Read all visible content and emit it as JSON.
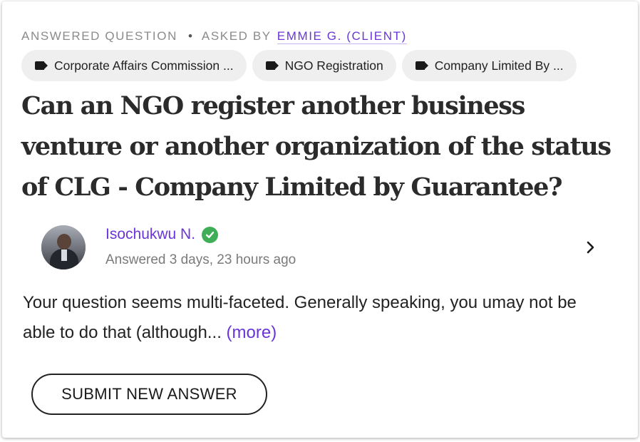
{
  "meta": {
    "status": "ANSWERED QUESTION",
    "separator": "•",
    "asked_by_label": "ASKED BY",
    "asker": "EMMIE G. (CLIENT)"
  },
  "tags": [
    {
      "label": "Corporate Affairs Commission ...",
      "icon": "tag-icon"
    },
    {
      "label": "NGO Registration",
      "icon": "tag-icon"
    },
    {
      "label": "Company Limited By ...",
      "icon": "tag-icon"
    }
  ],
  "question": {
    "title": "Can an NGO register another business venture or another organization of the status of CLG - Company Limited by Guarantee?"
  },
  "answer": {
    "answerer_name": "Isochukwu N.",
    "verified_icon": "check-circle-icon",
    "answered_time": "Answered 3 days, 23 hours ago",
    "excerpt": "Your question seems multi-faceted. Generally speaking, you umay not be able to do that (although...",
    "more_label": "(more)"
  },
  "actions": {
    "submit_label": "SUBMIT NEW ANSWER"
  },
  "colors": {
    "accent": "#6a35d9",
    "verified": "#3fae56",
    "tag_bg": "#efefef",
    "meta_text": "#8b8b8b"
  }
}
